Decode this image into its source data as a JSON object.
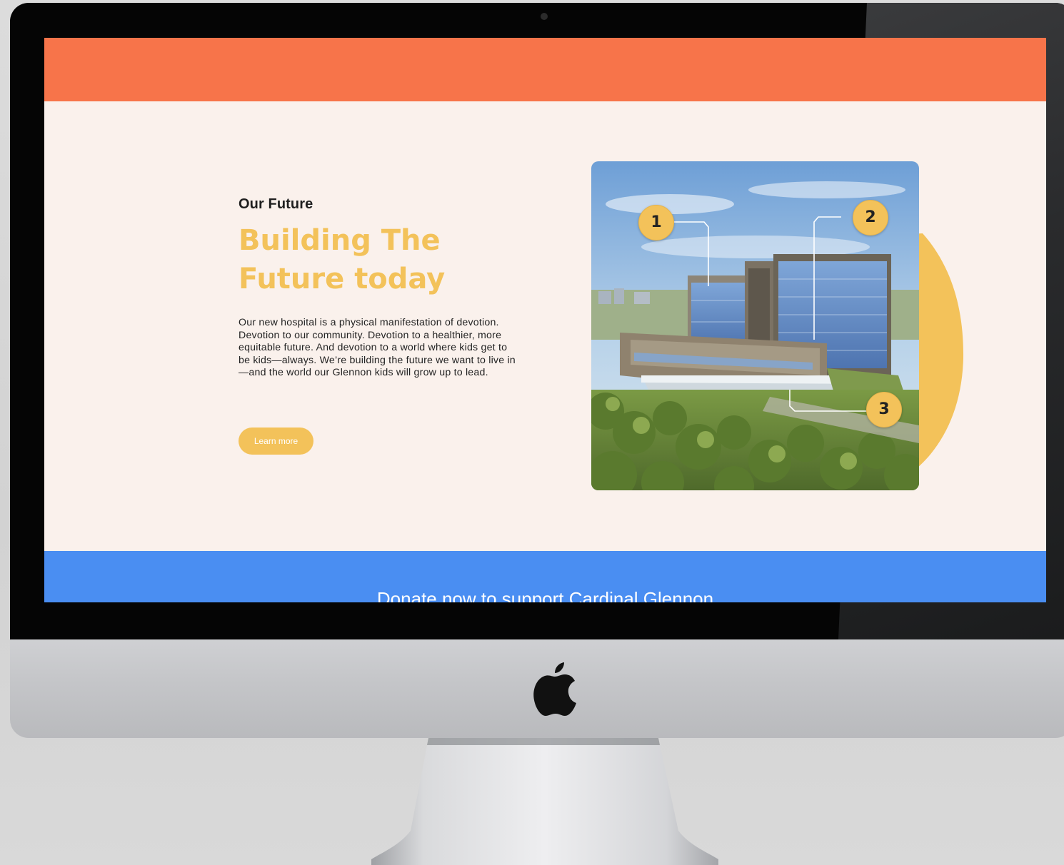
{
  "hero": {
    "eyebrow": "Our Future",
    "headline_line1": "Building The",
    "headline_line2": "Future today",
    "body": "Our new hospital is a physical manifestation of devotion. Devotion to our community. Devotion to a healthier, more equitable future. And devotion to a world where kids get to be kids—always. We’re building the future we want to live in—and the world our Glennon kids will grow up to lead.",
    "cta_label": "Learn more"
  },
  "image_markers": [
    "1",
    "2",
    "3"
  ],
  "donate": {
    "text": "Donate now to support Cardinal Glennon"
  },
  "colors": {
    "header_bar": "#f7744a",
    "page_background": "#faf1ec",
    "accent_yellow": "#f3c25a",
    "donate_bar": "#4a8ef2"
  },
  "icons": {
    "device_logo": "apple-logo-icon",
    "camera": "camera-icon"
  }
}
